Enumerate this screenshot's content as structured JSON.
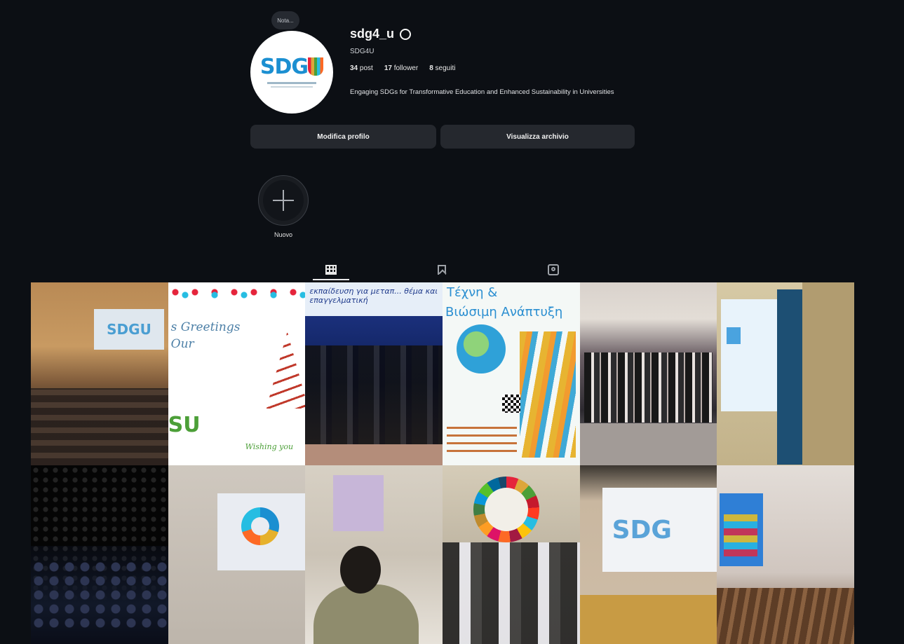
{
  "profile": {
    "note": "Nota...",
    "username": "sdg4_u",
    "fullname": "SDG4U",
    "stats": {
      "posts_count": "34",
      "posts_label": "post",
      "followers_count": "17",
      "followers_label": "follower",
      "following_count": "8",
      "following_label": "seguiti"
    },
    "bio": "Engaging SDGs for Transformative Education and Enhanced Sustainability in Universities",
    "logo_text": "SDG",
    "logo_u": "U"
  },
  "actions": {
    "edit_profile": "Modifica profilo",
    "view_archive": "Visualizza archivio"
  },
  "highlights": [
    {
      "label": "Nuovo"
    }
  ],
  "tabs": [
    {
      "name": "posts",
      "icon": "grid-icon",
      "active": true
    },
    {
      "name": "saved",
      "icon": "bookmark-icon",
      "active": false
    },
    {
      "name": "tagged",
      "icon": "tag-icon",
      "active": false
    }
  ],
  "posts": {
    "p1_screen": "SDGU",
    "p2_greeting_1": "s Greetings",
    "p2_greeting_2": "Our",
    "p2_logo": "SU",
    "p2_wish": "Wishing you",
    "p3_banner": "εκπαίδευση για μεταπ... θέμα και επαγγελματική",
    "p4_title_1": "Τέχνη &",
    "p4_title_2": "Βιώσιμη Ανάπτυξη",
    "p11_screen": "SDG"
  },
  "colors": {
    "background": "#0c0f14",
    "button_bg": "#25282e",
    "accent_blue": "#1b8fd1"
  }
}
